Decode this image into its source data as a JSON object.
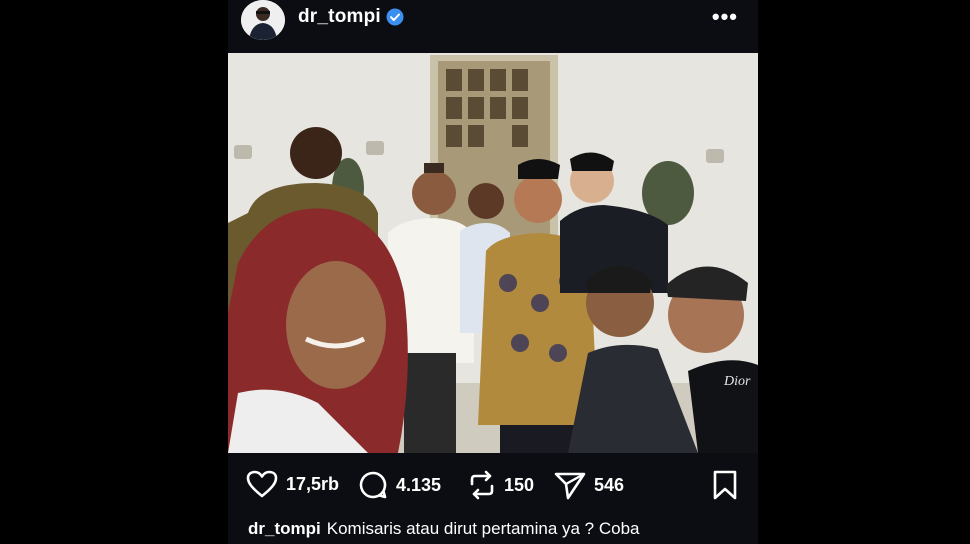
{
  "header": {
    "username": "dr_tompi",
    "verified_icon": "verified-badge-icon",
    "more_icon": "more-dots-icon",
    "more_label": "•••"
  },
  "photo": {
    "description_icon": "group-selfie-photo",
    "shirt_text": "Dior"
  },
  "actions": {
    "like_count": "17,5rb",
    "comment_count": "4.135",
    "repost_count": "150",
    "share_count": "546"
  },
  "caption": {
    "username": "dr_tompi",
    "text": "Komisaris atau dirut pertamina ya ? Coba"
  },
  "colors": {
    "background": "#000000",
    "post_background": "#0b0d12",
    "verified_blue": "#3b8ff0",
    "text": "#ffffff"
  }
}
